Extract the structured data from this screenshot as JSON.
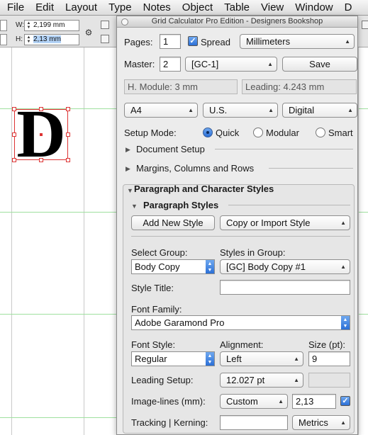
{
  "menubar": {
    "items": [
      "File",
      "Edit",
      "Layout",
      "Type",
      "Notes",
      "Object",
      "Table",
      "View",
      "Window",
      "D"
    ]
  },
  "controlbar": {
    "w_label": "W:",
    "w_value": "2,199 mm",
    "h_label": "H:",
    "h_value": "2,13 mm"
  },
  "canvas": {
    "glyph": "D"
  },
  "panel": {
    "title": "Grid Calculator Pro Edition - Designers Bookshop",
    "pages_label": "Pages:",
    "pages_value": "1",
    "spread_label": "Spread",
    "spread_checked": true,
    "units_value": "Millimeters",
    "master_label": "Master:",
    "master_value": "2",
    "master_prefix_value": "[GC-1]",
    "save_label": "Save",
    "h_module_value": "H. Module: 3 mm",
    "leading_value": "Leading: 4.243 mm",
    "paper_size_value": "A4",
    "paper_region_value": "U.S.",
    "output_value": "Digital",
    "setup_mode_label": "Setup Mode:",
    "setup_modes": [
      "Quick",
      "Modular",
      "Smart"
    ],
    "setup_mode_selected": "Quick",
    "document_setup_label": "Document Setup",
    "margins_label": "Margins, Columns and Rows",
    "para_char_label": "Paragraph and Character Styles",
    "paragraph_styles_label": "Paragraph Styles",
    "add_new_style_label": "Add New Style",
    "copy_import_label": "Copy or Import Style",
    "select_group_label": "Select Group:",
    "select_group_value": "Body Copy",
    "styles_in_group_label": "Styles in Group:",
    "styles_in_group_value": "[GC] Body Copy #1",
    "style_title_label": "Style Title:",
    "style_title_value": "",
    "font_family_label": "Font Family:",
    "font_family_value": "Adobe Garamond Pro",
    "font_style_label": "Font Style:",
    "font_style_value": "Regular",
    "alignment_label": "Alignment:",
    "alignment_value": "Left",
    "size_label": "Size (pt):",
    "size_value": "9",
    "leading_setup_label": "Leading Setup:",
    "leading_setup_value": "12.027 pt",
    "leading_extra_value": "",
    "image_lines_label": "Image-lines (mm):",
    "image_lines_mode": "Custom",
    "image_lines_value": "2,13",
    "image_lines_checked": true,
    "tracking_label": "Tracking | Kerning:",
    "tracking_value": "",
    "kerning_value": "Metrics"
  },
  "colors": {
    "accent": "#2b6fd6",
    "selection": "#d33333",
    "baseline_grid": "#9fe09f"
  }
}
